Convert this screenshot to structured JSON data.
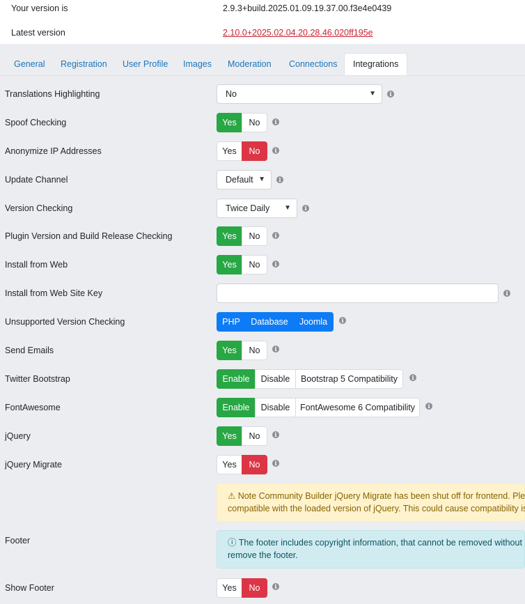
{
  "version_info": {
    "current_label": "Your version is",
    "current_value": "2.9.3+build.2025.01.09.19.37.00.f3e4e0439",
    "latest_label": "Latest version",
    "latest_value": "2.10.0+2025.02.04.20.28.46.020ff195e"
  },
  "tabs": [
    {
      "label": "General"
    },
    {
      "label": "Registration"
    },
    {
      "label": "User Profile"
    },
    {
      "label": "Images"
    },
    {
      "label": "Moderation"
    },
    {
      "label": "Connections"
    },
    {
      "label": "Integrations",
      "active": true
    }
  ],
  "settings": {
    "translations_highlighting": {
      "label": "Translations Highlighting",
      "value": "No"
    },
    "spoof_checking": {
      "label": "Spoof Checking",
      "yes": "Yes",
      "no": "No",
      "selected": "Yes"
    },
    "anonymize_ip": {
      "label": "Anonymize IP Addresses",
      "yes": "Yes",
      "no": "No",
      "selected": "No"
    },
    "update_channel": {
      "label": "Update Channel",
      "value": "Default"
    },
    "version_checking": {
      "label": "Version Checking",
      "value": "Twice Daily"
    },
    "plugin_version_checking": {
      "label": "Plugin Version and Build Release Checking",
      "yes": "Yes",
      "no": "No",
      "selected": "Yes"
    },
    "install_from_web": {
      "label": "Install from Web",
      "yes": "Yes",
      "no": "No",
      "selected": "Yes"
    },
    "install_site_key": {
      "label": "Install from Web Site Key",
      "value": ""
    },
    "unsupported_version_checking": {
      "label": "Unsupported Version Checking",
      "options": [
        "PHP",
        "Database",
        "Joomla"
      ]
    },
    "send_emails": {
      "label": "Send Emails",
      "yes": "Yes",
      "no": "No",
      "selected": "Yes"
    },
    "twitter_bootstrap": {
      "label": "Twitter Bootstrap",
      "options": [
        "Enable",
        "Disable",
        "Bootstrap 5 Compatibility"
      ],
      "selected": "Enable"
    },
    "fontawesome": {
      "label": "FontAwesome",
      "options": [
        "Enable",
        "Disable",
        "FontAwesome 6 Compatibility"
      ],
      "selected": "Enable"
    },
    "jquery": {
      "label": "jQuery",
      "yes": "Yes",
      "no": "No",
      "selected": "Yes"
    },
    "jquery_migrate": {
      "label": "jQuery Migrate",
      "yes": "Yes",
      "no": "No",
      "selected": "No"
    },
    "jquery_migrate_note": {
      "line1": "Note Community Builder jQuery Migrate has been shut off for frontend. Please",
      "line2": "compatible with the loaded version of jQuery. This could cause compatibility issu"
    },
    "footer": {
      "label": "Footer",
      "line1": "The footer includes copyright information, that cannot be removed without CB",
      "line2": "remove the footer."
    },
    "show_footer": {
      "label": "Show Footer",
      "yes": "Yes",
      "no": "No",
      "selected": "No"
    }
  },
  "icons": {
    "info": "info-circle-icon",
    "warning": "warning-triangle-icon",
    "chevron": "chevron-down-icon"
  },
  "colors": {
    "yes_active": "#28a745",
    "no_active": "#dc3545",
    "primary": "#0d7bf5",
    "link": "#1b75bb"
  }
}
